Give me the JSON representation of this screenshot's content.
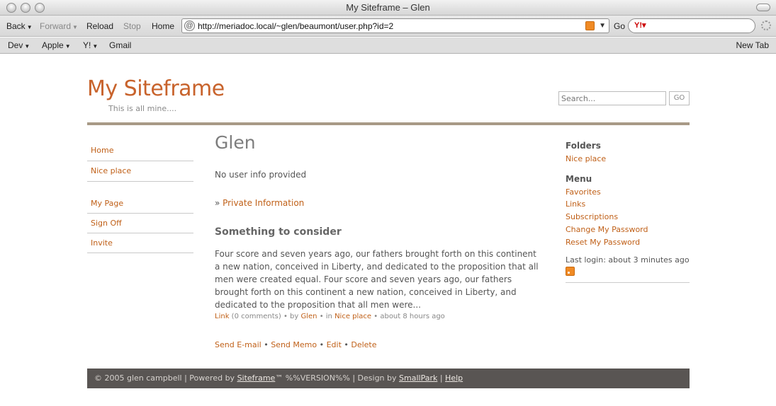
{
  "window": {
    "title": "My Siteframe – Glen"
  },
  "toolbar": {
    "back": "Back",
    "forward": "Forward",
    "reload": "Reload",
    "stop": "Stop",
    "home": "Home",
    "url": "http://meriadoc.local/~glen/beaumont/user.php?id=2",
    "go": "Go"
  },
  "bookmarks": {
    "items": [
      "Dev",
      "Apple",
      "Y!",
      "Gmail"
    ],
    "new_tab": "New Tab"
  },
  "site": {
    "title": "My Siteframe",
    "tagline": "This is all mine....",
    "search_placeholder": "Search...",
    "search_button": "GO"
  },
  "left_nav": {
    "group1": [
      "Home",
      "Nice place"
    ],
    "group2": [
      "My Page",
      "Sign Off",
      "Invite"
    ]
  },
  "main": {
    "heading": "Glen",
    "user_info": "No user info provided",
    "private_prefix": "» ",
    "private_link": "Private Information",
    "post_title": "Something to consider",
    "post_body": "Four score and seven years ago, our fathers brought forth on this continent a new nation, conceived in Liberty, and dedicated to the proposition that all men were created equal. Four score and seven years ago, our fathers brought forth on this continent a new nation, conceived in Liberty, and dedicated to the proposition that all men were...",
    "meta": {
      "link": "Link",
      "comments": "(0 comments)",
      "by": "• by",
      "author": "Glen",
      "in": "• in",
      "folder": "Nice place",
      "time": "• about 8 hours ago"
    },
    "actions": [
      "Send E-mail",
      "Send Memo",
      "Edit",
      "Delete"
    ],
    "action_sep": " • "
  },
  "sidebar": {
    "folders_heading": "Folders",
    "folders": [
      "Nice place"
    ],
    "menu_heading": "Menu",
    "menu": [
      "Favorites",
      "Links",
      "Subscriptions",
      "Change My Password",
      "Reset My Password"
    ],
    "last_login": "Last login: about 3 minutes ago"
  },
  "footer": {
    "copyright": "© 2005 glen campbell | Powered by ",
    "siteframe": "Siteframe",
    "version": "™ %%VERSION%% | Design by ",
    "smallpark": "SmallPark",
    "sep": " | ",
    "help": "Help"
  },
  "colors": {
    "accent": "#c8632c",
    "link": "#c06018",
    "rule": "#a89a86",
    "footer_bg": "#595553"
  }
}
